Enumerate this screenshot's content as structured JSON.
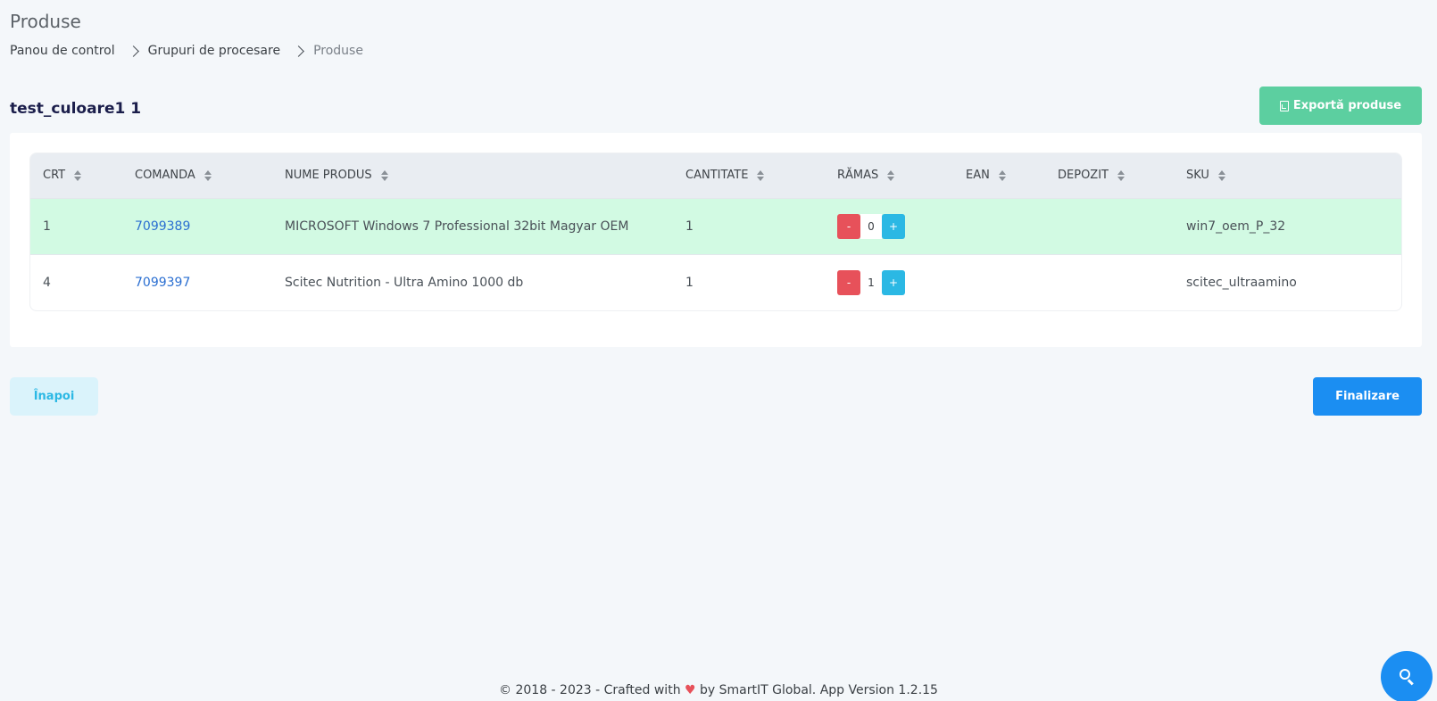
{
  "page": {
    "title": "Produse"
  },
  "breadcrumb": [
    "Panou de control",
    "Grupuri de procesare",
    "Produse"
  ],
  "group": {
    "title": "test_culoare1 1"
  },
  "actions": {
    "export_label": "Exportă produse",
    "back_label": "Înapoi",
    "finish_label": "Finalizare"
  },
  "table": {
    "columns": [
      "CRT",
      "COMANDA",
      "NUME PRODUS",
      "CANTITATE",
      "RĂMAS",
      "EAN",
      "DEPOZIT",
      "SKU"
    ],
    "rows": [
      {
        "crt": "1",
        "comanda": "7099389",
        "nume": "MICROSOFT Windows 7 Professional 32bit Magyar OEM",
        "cantitate": "1",
        "ramas": "0",
        "ean": "",
        "depozit": "",
        "sku": "win7_oem_P_32"
      },
      {
        "crt": "4",
        "comanda": "7099397",
        "nume": "Scitec Nutrition - Ultra Amino 1000 db",
        "cantitate": "1",
        "ramas": "1",
        "ean": "",
        "depozit": "",
        "sku": "scitec_ultraamino"
      }
    ],
    "stepper": {
      "minus": "-",
      "plus": "+"
    }
  },
  "footer": {
    "prefix": "© 2018 - 2023 - Crafted with",
    "heart": "♥",
    "suffix": "by SmartIT Global. App Version 1.2.15"
  },
  "colors": {
    "success_row": "#d2fae3",
    "export_button": "#5ccfa0",
    "primary": "#1b8ef2",
    "minus_button": "#e7515a",
    "plus_button": "#2bb8e4"
  }
}
